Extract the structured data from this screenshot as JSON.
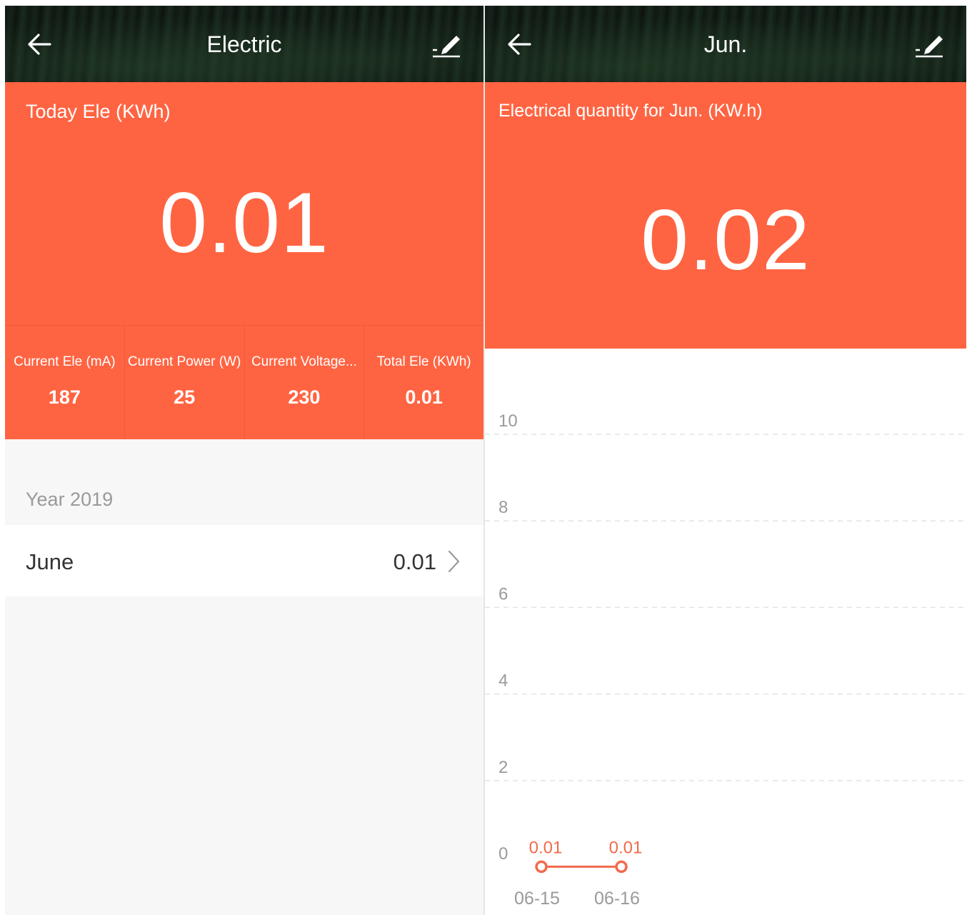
{
  "left": {
    "title": "Electric",
    "today_label": "Today Ele (KWh)",
    "today_value": "0.01",
    "stats": [
      {
        "label": "Current Ele (mA)",
        "value": "187"
      },
      {
        "label": "Current Power (W)",
        "value": "25"
      },
      {
        "label": "Current Voltage...",
        "value": "230"
      },
      {
        "label": "Total Ele (KWh)",
        "value": "0.01"
      }
    ],
    "year_label": "Year 2019",
    "month": {
      "name": "June",
      "value": "0.01"
    }
  },
  "right": {
    "title": "Jun.",
    "subtitle": "Electrical quantity for Jun. (KW.h)",
    "value": "0.02"
  },
  "colors": {
    "accent": "#ff6442",
    "header_bg": "#121a14"
  },
  "icons": {
    "back": "arrow-left-icon",
    "edit": "pencil-edit-icon",
    "chevron": "chevron-right-icon"
  },
  "chart_data": {
    "type": "line",
    "x": [
      "06-15",
      "06-16"
    ],
    "series": [
      {
        "values": [
          0.01,
          0.01
        ]
      }
    ],
    "data_labels": [
      "0.01",
      "0.01"
    ],
    "yticks": [
      0,
      2,
      4,
      6,
      8,
      10
    ],
    "ylim": [
      0,
      10
    ],
    "grid": true,
    "color": "#f26a4b"
  }
}
